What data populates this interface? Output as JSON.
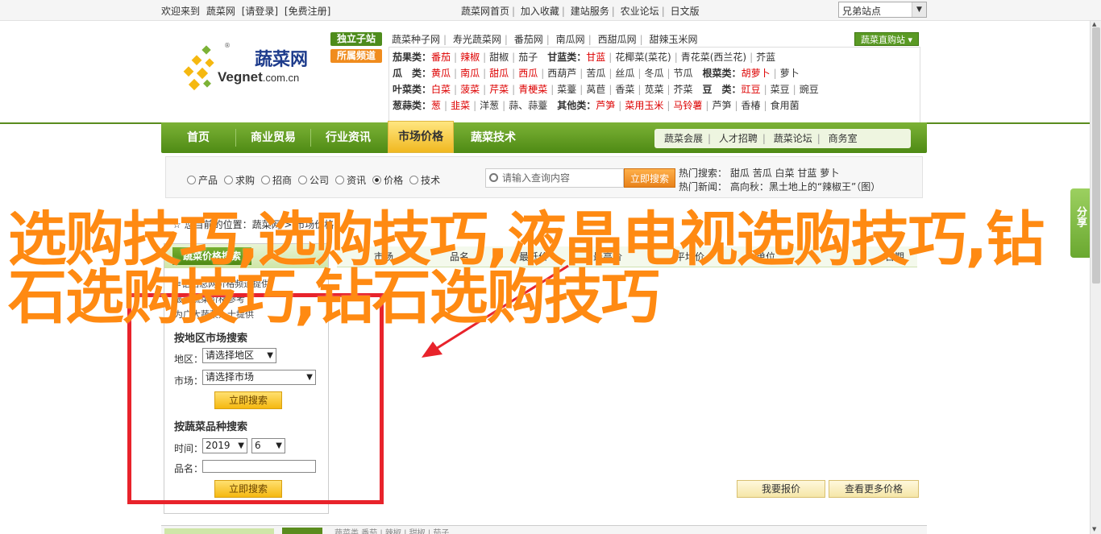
{
  "topbar": {
    "welcome": "欢迎来到",
    "site": "蔬菜网",
    "login": "[请登录]",
    "register": "[免费注册]",
    "links": [
      "蔬菜网首页",
      "加入收藏",
      "建站服务",
      "农业论坛",
      "日文版"
    ],
    "select_value": "兄弟站点"
  },
  "logo": {
    "cn": "蔬菜网",
    "en": "Vegnet",
    "domain": ".com.cn",
    "reg": "®"
  },
  "header": {
    "tag1": "独立子站",
    "tag2": "所属频道",
    "row1": [
      "蔬菜种子网",
      "寿光蔬菜网",
      "番茄网",
      "南瓜网",
      "西甜瓜网",
      "甜辣玉米网"
    ],
    "direct": "蔬菜直购站 ▾",
    "rows": [
      {
        "label": "茄果类：",
        "items": [
          {
            "t": "番茄",
            "hot": true
          },
          {
            "t": "辣椒",
            "hot": true
          },
          {
            "t": "甜椒"
          },
          {
            "t": "茄子"
          }
        ],
        "label2": "甘蓝类：",
        "items2": [
          {
            "t": "甘蓝",
            "hot": true
          },
          {
            "t": "花椰菜(菜花)"
          },
          {
            "t": "青花菜(西兰花)"
          },
          {
            "t": "芥蓝"
          }
        ]
      },
      {
        "label": "瓜　类：",
        "items": [
          {
            "t": "黄瓜",
            "hot": true
          },
          {
            "t": "南瓜",
            "hot": true
          },
          {
            "t": "甜瓜",
            "hot": true
          },
          {
            "t": "西瓜",
            "hot": true
          },
          {
            "t": "西葫芦"
          },
          {
            "t": "苦瓜"
          },
          {
            "t": "丝瓜"
          },
          {
            "t": "冬瓜"
          },
          {
            "t": "节瓜"
          }
        ],
        "label2": "根菜类：",
        "items2": [
          {
            "t": "胡萝卜",
            "hot": true
          },
          {
            "t": "萝卜"
          }
        ]
      },
      {
        "label": "叶菜类：",
        "items": [
          {
            "t": "白菜",
            "hot": true
          },
          {
            "t": "菠菜",
            "hot": true
          },
          {
            "t": "芹菜",
            "hot": true
          },
          {
            "t": "青梗菜",
            "hot": true
          },
          {
            "t": "菜薹"
          },
          {
            "t": "莴苣"
          },
          {
            "t": "香菜"
          },
          {
            "t": "苋菜"
          },
          {
            "t": "芥菜"
          }
        ],
        "label2": "豆　类：",
        "items2": [
          {
            "t": "豇豆",
            "hot": true
          },
          {
            "t": "菜豆"
          },
          {
            "t": "豌豆"
          }
        ]
      },
      {
        "label": "葱蒜类：",
        "items": [
          {
            "t": "葱",
            "hot": true
          },
          {
            "t": "韭菜",
            "hot": true
          },
          {
            "t": "洋葱"
          },
          {
            "t": "蒜、蒜薹"
          }
        ],
        "label2": "其他类：",
        "items2": [
          {
            "t": "芦笋",
            "hot": true
          },
          {
            "t": "菜用玉米",
            "hot": true
          },
          {
            "t": "马铃薯",
            "hot": true
          },
          {
            "t": "芦笋"
          },
          {
            "t": "香椿"
          },
          {
            "t": "食用菌"
          }
        ]
      }
    ]
  },
  "nav": {
    "items": [
      "首页",
      "商业贸易",
      "行业资讯",
      "市场价格",
      "蔬菜技术"
    ],
    "sub": [
      "蔬菜会展",
      "人才招聘",
      "蔬菜论坛",
      "商务室"
    ]
  },
  "search": {
    "radios": [
      "产品",
      "求购",
      "招商",
      "公司",
      "资讯",
      "价格",
      "技术"
    ],
    "selected": "价格",
    "placeholder": "请输入查询内容",
    "button": "立即搜索",
    "hot_label": "热门搜索：",
    "hot": [
      "甜瓜",
      "苦瓜",
      "白菜",
      "甘蓝",
      "萝卜"
    ],
    "news_label": "热门新闻：",
    "news": "高向秋：黑土地上的“辣椒王”（图）"
  },
  "breadcrumb": "☆ 您目前的位置：蔬菜网 > 市场价格",
  "leftpanel": {
    "head": "蔬菜价格搜索",
    "text1": "≡钻石总网价格频道提供",
    "text2": "最新蔬菜价格参考",
    "text3": "为广大蔬菜人士提供",
    "region_title": "按地区市场搜索",
    "region_label": "地区：",
    "region_value": "请选择地区",
    "market_label": "市场：",
    "market_value": "请选择市场",
    "search_btn": "立即搜索",
    "variety_title": "按蔬菜品种搜索",
    "time_label": "时间：",
    "year": "2019",
    "month": "6",
    "name_label": "品名：",
    "search_btn2": "立即搜索"
  },
  "market": {
    "cols": [
      "市场",
      "品名",
      "最低价",
      "最高价",
      "平均价",
      "单位",
      "日期"
    ]
  },
  "buttons": {
    "report": "我要报价",
    "more": "查看更多价格"
  },
  "bottom": {
    "text": "蔬菜类  番茄  |  辣椒  |  甜椒  |  茄子"
  },
  "share": "分享",
  "overlay_title": "选购技巧,选购技巧,液晶电视选购技巧,钻石选购技巧,钻石选购技巧",
  "colors": {
    "green": "#5a8c1e",
    "orange": "#ff8a12",
    "red": "#e8232b"
  }
}
